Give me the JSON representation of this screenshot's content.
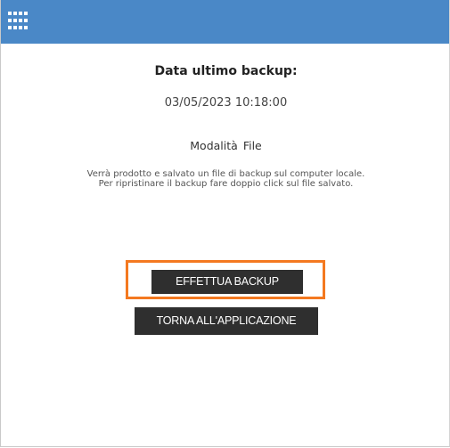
{
  "header": {
    "menu_icon": "app-grid-icon",
    "color": "#4a88c7"
  },
  "backup": {
    "title": "Data ultimo backup:",
    "last_date": "03/05/2023 10:18:00",
    "mode_label": "Modalità",
    "mode_value": "File",
    "description_line1": "Verrà prodotto e salvato un file di backup sul computer locale.",
    "description_line2": "Per ripristinare il backup fare doppio click sul file salvato."
  },
  "buttons": {
    "backup_label": "EFFETTUA BACKUP",
    "back_label": "TORNA ALL'APPLICAZIONE"
  },
  "highlight_color": "#f47920"
}
